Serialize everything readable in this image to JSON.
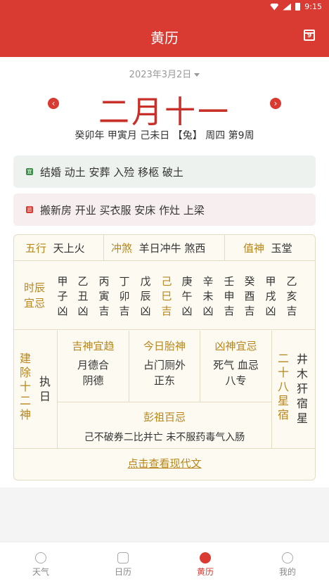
{
  "status_bar": {
    "time": "9:15"
  },
  "header": {
    "title": "黄历",
    "calendar_button_label": "9"
  },
  "date_selector": {
    "value": "2023年3月2日"
  },
  "lunar_date": "二月十一",
  "ganzhi_line": "癸卯年 甲寅月 己未日 【兔】 周四 第9周",
  "yi": {
    "tag": "宜",
    "text": "结婚 动土 安葬 入殓 移柩 破土"
  },
  "ji": {
    "tag": "忌",
    "text": "搬新房 开业 买衣服 安床 作灶 上梁"
  },
  "table": {
    "wuxing_label": "五行",
    "wuxing_value": "天上火",
    "chongsha_label": "冲煞",
    "chongsha_value": "羊日冲牛 煞西",
    "zhishen_label": "值神",
    "zhishen_value": "玉堂",
    "shichen_label": "时辰宜忌",
    "shichen": [
      {
        "gan": "甲",
        "zhi": "子",
        "luck": "凶"
      },
      {
        "gan": "乙",
        "zhi": "丑",
        "luck": "凶"
      },
      {
        "gan": "丙",
        "zhi": "寅",
        "luck": "吉"
      },
      {
        "gan": "丁",
        "zhi": "卯",
        "luck": "吉"
      },
      {
        "gan": "戊",
        "zhi": "辰",
        "luck": "凶"
      },
      {
        "gan": "己",
        "zhi": "巳",
        "luck": "吉"
      },
      {
        "gan": "庚",
        "zhi": "午",
        "luck": "凶"
      },
      {
        "gan": "辛",
        "zhi": "未",
        "luck": "凶"
      },
      {
        "gan": "壬",
        "zhi": "申",
        "luck": "吉"
      },
      {
        "gan": "癸",
        "zhi": "酉",
        "luck": "吉"
      },
      {
        "gan": "甲",
        "zhi": "戌",
        "luck": "凶"
      },
      {
        "gan": "乙",
        "zhi": "亥",
        "luck": "吉"
      }
    ],
    "jianchu_label": "建除十二神",
    "jianchu_value": "执日",
    "jishen_label": "吉神宜趋",
    "jishen_value_1": "月德合",
    "jishen_value_2": "阴德",
    "taishen_label": "今日胎神",
    "taishen_value_1": "占门厕外",
    "taishen_value_2": "正东",
    "xiongshen_label": "凶神宜忌",
    "xiongshen_value_1": "死气 血忌",
    "xiongshen_value_2": "八专",
    "pengzu_label": "彭祖百忌",
    "pengzu_value": "己不破券二比并亡 未不服药毒气入肠",
    "xiu_label": "二十八星宿",
    "xiu_value": "井木犴宿星",
    "modern_link": "点击查看现代文"
  },
  "nav": [
    {
      "label": "天气"
    },
    {
      "label": "日历"
    },
    {
      "label": "黄历"
    },
    {
      "label": "我的"
    }
  ],
  "colors": {
    "brand": "#d93a31",
    "gold": "#b8861b"
  }
}
